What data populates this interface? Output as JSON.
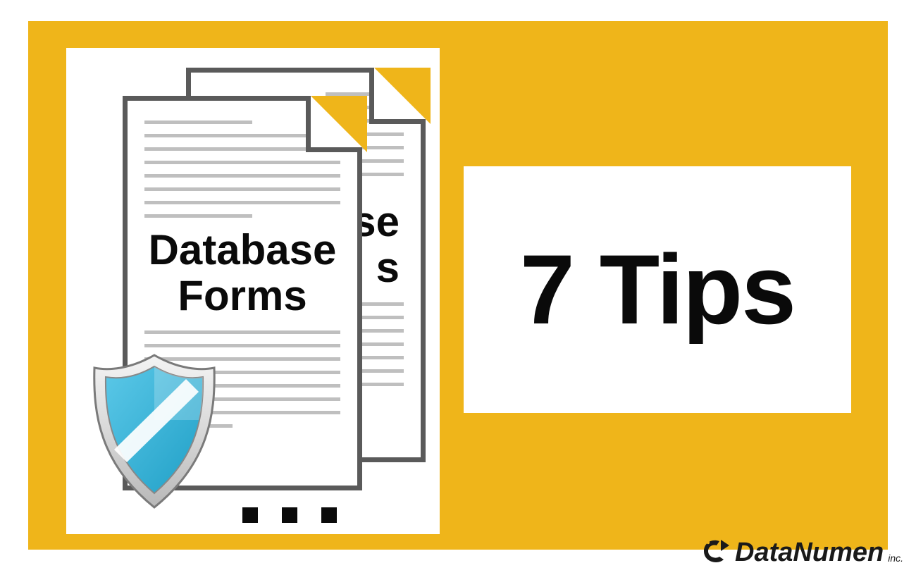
{
  "document": {
    "title_line1": "Database",
    "title_line2": "Forms",
    "back_fragment1": "se",
    "back_fragment2": "s"
  },
  "tips": {
    "label": "7 Tips"
  },
  "logo": {
    "brand": "DataNumen",
    "suffix": "inc."
  },
  "colors": {
    "accent": "#efb51a",
    "shield_fill": "#35b6dd",
    "doc_border": "#5a5a5a",
    "text": "#0a0a0a"
  },
  "icons": {
    "shield": "shield-icon",
    "logo": "datanumen-logo-icon"
  }
}
